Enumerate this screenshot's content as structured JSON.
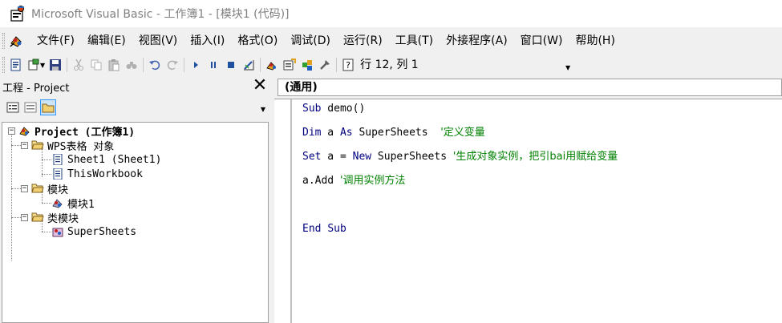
{
  "window": {
    "title": "Microsoft Visual Basic - 工作簿1 - [模块1 (代码)]"
  },
  "menu": {
    "items": [
      "文件(F)",
      "编辑(E)",
      "视图(V)",
      "插入(I)",
      "格式(O)",
      "调试(D)",
      "运行(R)",
      "工具(T)",
      "外接程序(A)",
      "窗口(W)",
      "帮助(H)"
    ]
  },
  "toolbar": {
    "position_text": "行 12, 列 1"
  },
  "project_panel": {
    "title": "工程 - Project",
    "close_glyph": "✕",
    "tree": [
      {
        "label": "Project (工作簿1)",
        "expander": "⊟"
      },
      {
        "label": "WPS表格 对象",
        "expander": "⊟"
      },
      {
        "label": "Sheet1 (Sheet1)"
      },
      {
        "label": "ThisWorkbook"
      },
      {
        "label": "模块",
        "expander": "⊟"
      },
      {
        "label": "模块1"
      },
      {
        "label": "类模块",
        "expander": "⊟"
      },
      {
        "label": "SuperSheets"
      }
    ]
  },
  "code_window": {
    "object_combo": "(通用)",
    "lines": [
      {
        "kw1": "Sub",
        "rest": " demo()"
      },
      {
        "kw1": "Dim",
        "mid1": " a ",
        "kw2": "As",
        "mid2": " SuperSheets  ",
        "comment": "'定义变量"
      },
      {
        "kw1": "Set",
        "mid1": " a = ",
        "kw2": "New",
        "mid2": " SuperSheets ",
        "comment": "'生成对象实例，把引bai用赋给变量"
      },
      {
        "rest": "a.Add ",
        "comment": "'调用实例方法"
      },
      {
        "kw1": "End",
        "mid1": " ",
        "kw2": "Sub"
      }
    ]
  },
  "colors": {
    "keyword": "#000080",
    "comment": "#008000"
  }
}
